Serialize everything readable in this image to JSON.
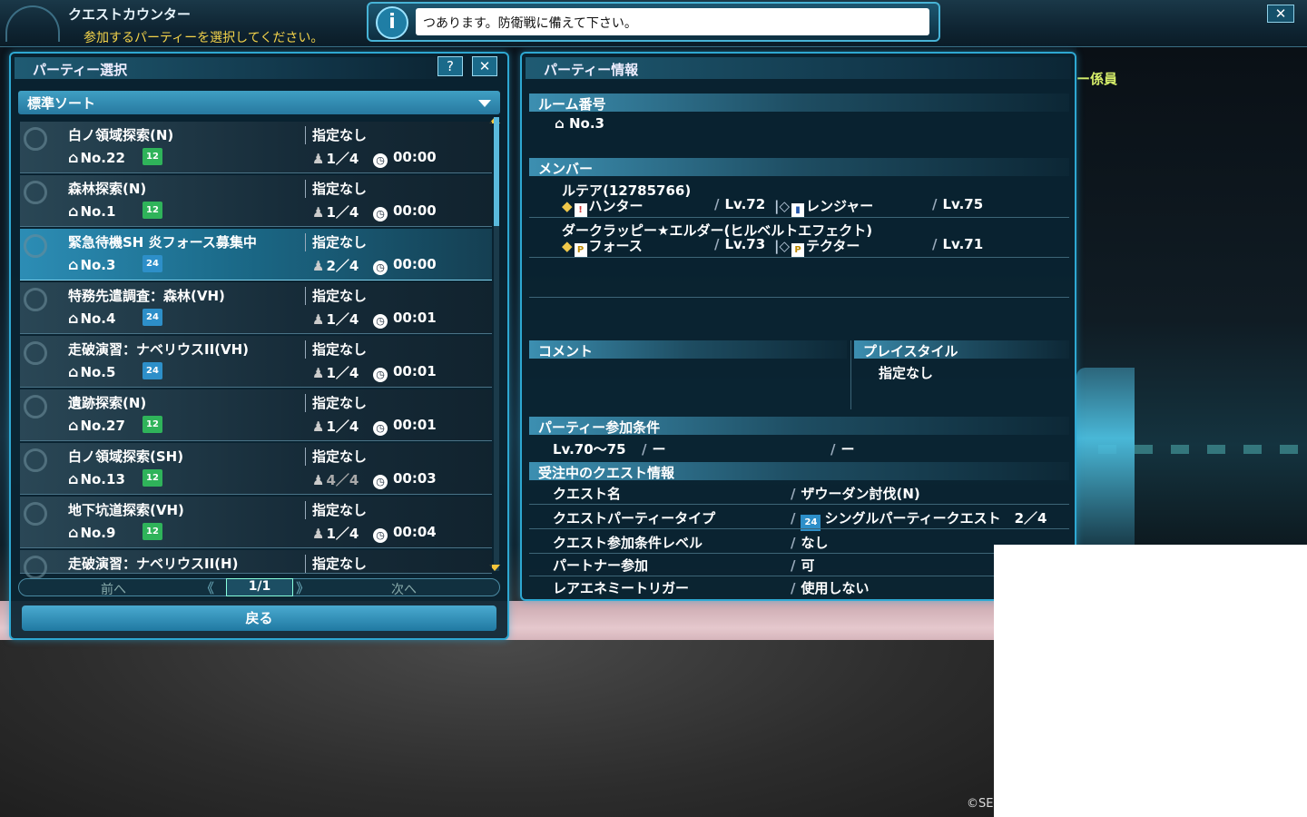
{
  "window": {
    "title": "クエストカウンター",
    "subtitle": "参加するパーティーを選択してください。",
    "close_label": "✕"
  },
  "info_bar": {
    "icon_text": "i",
    "message": "つあります。防衛戦に備えて下さい。"
  },
  "background": {
    "staff_name": "ー係員",
    "copyright": "©SE"
  },
  "left_panel": {
    "title": "パーティー選択",
    "help_label": "?",
    "close_label": "✕",
    "sort_label": "標準ソート",
    "rows": [
      {
        "name": "白ノ領域探索(N)",
        "condition": "指定なし",
        "room": "No.22",
        "badge": "12",
        "badge_color": "green",
        "count": "1／4",
        "time": "00:00"
      },
      {
        "name": "森林探索(N)",
        "condition": "指定なし",
        "room": "No.1",
        "badge": "12",
        "badge_color": "green",
        "count": "1／4",
        "time": "00:00"
      },
      {
        "name": "緊急待機SH 炎フォース募集中",
        "condition": "指定なし",
        "room": "No.3",
        "badge": "24",
        "badge_color": "blue",
        "count": "2／4",
        "time": "00:00"
      },
      {
        "name": "特務先遣調査：森林(VH)",
        "condition": "指定なし",
        "room": "No.4",
        "badge": "24",
        "badge_color": "blue",
        "count": "1／4",
        "time": "00:01"
      },
      {
        "name": "走破演習：ナベリウスII(VH)",
        "condition": "指定なし",
        "room": "No.5",
        "badge": "24",
        "badge_color": "blue",
        "count": "1／4",
        "time": "00:01"
      },
      {
        "name": "遺跡探索(N)",
        "condition": "指定なし",
        "room": "No.27",
        "badge": "12",
        "badge_color": "green",
        "count": "1／4",
        "time": "00:01"
      },
      {
        "name": "白ノ領域探索(SH)",
        "condition": "指定なし",
        "room": "No.13",
        "badge": "12",
        "badge_color": "green",
        "count": "4／4",
        "time": "00:03"
      },
      {
        "name": "地下坑道探索(VH)",
        "condition": "指定なし",
        "room": "No.9",
        "badge": "12",
        "badge_color": "green",
        "count": "1／4",
        "time": "00:04"
      },
      {
        "name": "走破演習：ナベリウスII(H)",
        "condition": "指定なし"
      }
    ],
    "pager": {
      "prev": "前へ",
      "page": "1/1",
      "next": "次へ"
    },
    "back_label": "戻る"
  },
  "right_panel": {
    "title": "パーティー情報",
    "room_heading": "ルーム番号",
    "room_value": "No.3",
    "member_heading": "メンバー",
    "members": [
      {
        "name": "ルテア(12785766)",
        "main_class": "ハンター",
        "main_lv": "Lv.72",
        "sub_class": "レンジャー",
        "sub_lv": "Lv.75"
      },
      {
        "name": "ダークラッピー★エルダー(ヒルベルトエフェクト)",
        "main_class": "フォース",
        "main_lv": "Lv.73",
        "sub_class": "テクター",
        "sub_lv": "Lv.71"
      }
    ],
    "comment_heading": "コメント",
    "playstyle_heading": "プレイスタイル",
    "playstyle_value": "指定なし",
    "conditions_heading": "パーティー参加条件",
    "conditions": {
      "level": "Lv.70～75",
      "cond2": "ー",
      "cond3": "ー"
    },
    "quest_heading": "受注中のクエスト情報",
    "quest_rows": [
      {
        "label": "クエスト名",
        "value": "ザウーダン討伐(N)"
      },
      {
        "label": "クエストパーティータイプ",
        "value": "シングルパーティークエスト　2／4"
      },
      {
        "label": "クエスト参加条件レベル",
        "value": "なし"
      },
      {
        "label": "パートナー参加",
        "value": "可"
      },
      {
        "label": "レアエネミートリガー",
        "value": "使用しない"
      }
    ]
  },
  "colors": {
    "accent": "#2ea8d2",
    "subtitle": "#f3d34a",
    "badge_green": "#2fb35a",
    "badge_blue": "#2d8fc9"
  }
}
